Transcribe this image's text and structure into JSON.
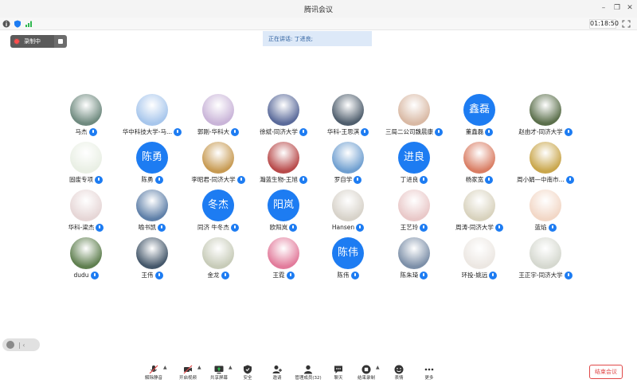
{
  "window": {
    "title": "腾讯会议"
  },
  "status": {
    "timer": "01:18:50"
  },
  "recording": {
    "label": "录制中"
  },
  "speaking": {
    "text": "正在讲话: 丁进良;"
  },
  "participants": [
    {
      "name": "马杰",
      "avatar_text": "",
      "photo_color": "#6f8a7f"
    },
    {
      "name": "华中科技大学-马...",
      "avatar_text": "",
      "photo_color": "#a7c6ec"
    },
    {
      "name": "郭刚-华科大",
      "avatar_text": "",
      "photo_color": "#c9b4d8"
    },
    {
      "name": "徐斌-同济大学",
      "avatar_text": "",
      "photo_color": "#5a6a9a"
    },
    {
      "name": "华科-王思淇",
      "avatar_text": "",
      "photo_color": "#4f5e6d"
    },
    {
      "name": "三局二公司魏晨康",
      "avatar_text": "",
      "photo_color": "#d9b9a4"
    },
    {
      "name": "董鑫磊",
      "avatar_text": "鑫磊",
      "photo_color": "#1d7cf2"
    },
    {
      "name": "赵由才-同济大学",
      "avatar_text": "",
      "photo_color": "#5b6f4b"
    },
    {
      "name": "固废专项",
      "avatar_text": "",
      "photo_color": "#e9efe4"
    },
    {
      "name": "陈勇",
      "avatar_text": "陈勇",
      "photo_color": "#1d7cf2"
    },
    {
      "name": "李昭君-同济大学",
      "avatar_text": "",
      "photo_color": "#c79a52"
    },
    {
      "name": "瀚蓝生物-王旭",
      "avatar_text": "",
      "photo_color": "#b84a4a"
    },
    {
      "name": "罗自学",
      "avatar_text": "",
      "photo_color": "#6f9fd0"
    },
    {
      "name": "丁进良",
      "avatar_text": "进良",
      "photo_color": "#1d7cf2"
    },
    {
      "name": "杨家宽",
      "avatar_text": "",
      "photo_color": "#d97d63"
    },
    {
      "name": "周小娟—中南市...",
      "avatar_text": "",
      "photo_color": "#c9a64b"
    },
    {
      "name": "华科-梁杰",
      "avatar_text": "",
      "photo_color": "#e6d6d6"
    },
    {
      "name": "喻书凯",
      "avatar_text": "",
      "photo_color": "#5e7fa8"
    },
    {
      "name": "同济 牛冬杰",
      "avatar_text": "冬杰",
      "photo_color": "#1d7cf2"
    },
    {
      "name": "欧阳岚",
      "avatar_text": "阳岚",
      "photo_color": "#1d7cf2"
    },
    {
      "name": "Hansen",
      "avatar_text": "",
      "photo_color": "#d7d2c9"
    },
    {
      "name": "王艺玲",
      "avatar_text": "",
      "photo_color": "#e9c8c8"
    },
    {
      "name": "周涛-同济大学",
      "avatar_text": "",
      "photo_color": "#d8d2bd"
    },
    {
      "name": "蓝焰",
      "avatar_text": "",
      "photo_color": "#f2d7c6"
    },
    {
      "name": "dudu",
      "avatar_text": "",
      "photo_color": "#5f7f4f"
    },
    {
      "name": "王伟",
      "avatar_text": "",
      "photo_color": "#44576a"
    },
    {
      "name": "金龙",
      "avatar_text": "",
      "photo_color": "#c7cbb8"
    },
    {
      "name": "王霓",
      "avatar_text": "",
      "photo_color": "#e27b9b"
    },
    {
      "name": "陈伟",
      "avatar_text": "陈伟",
      "photo_color": "#1d7cf2"
    },
    {
      "name": "陈朱琦",
      "avatar_text": "",
      "photo_color": "#7c8fa8"
    },
    {
      "name": "环投-姚远",
      "avatar_text": "",
      "photo_color": "#ece7e2"
    },
    {
      "name": "王正宇-同济大学",
      "avatar_text": "",
      "photo_color": "#d5d8cf"
    }
  ],
  "toolbar": [
    {
      "id": "unmute",
      "label": "解除静音",
      "icon": "mic-off-icon",
      "caret": true
    },
    {
      "id": "video",
      "label": "开启视频",
      "icon": "camera-off-icon",
      "caret": true
    },
    {
      "id": "share",
      "label": "共享屏幕",
      "icon": "screen-share-icon",
      "caret": true
    },
    {
      "id": "security",
      "label": "安全",
      "icon": "shield-icon",
      "caret": false
    },
    {
      "id": "invite",
      "label": "邀请",
      "icon": "invite-icon",
      "caret": false
    },
    {
      "id": "members",
      "label": "管理成员(32)",
      "icon": "members-icon",
      "caret": false
    },
    {
      "id": "chat",
      "label": "聊天",
      "icon": "chat-icon",
      "caret": false
    },
    {
      "id": "record",
      "label": "结束录制",
      "icon": "record-stop-icon",
      "caret": true
    },
    {
      "id": "emoji",
      "label": "表情",
      "icon": "emoji-icon",
      "caret": false
    },
    {
      "id": "more",
      "label": "更多",
      "icon": "more-icon",
      "caret": false
    }
  ],
  "end_meeting": "结束会议",
  "colors": {
    "accent": "#1d7cf2",
    "danger": "#e04848",
    "speaking_bg": "#dde9f8"
  }
}
